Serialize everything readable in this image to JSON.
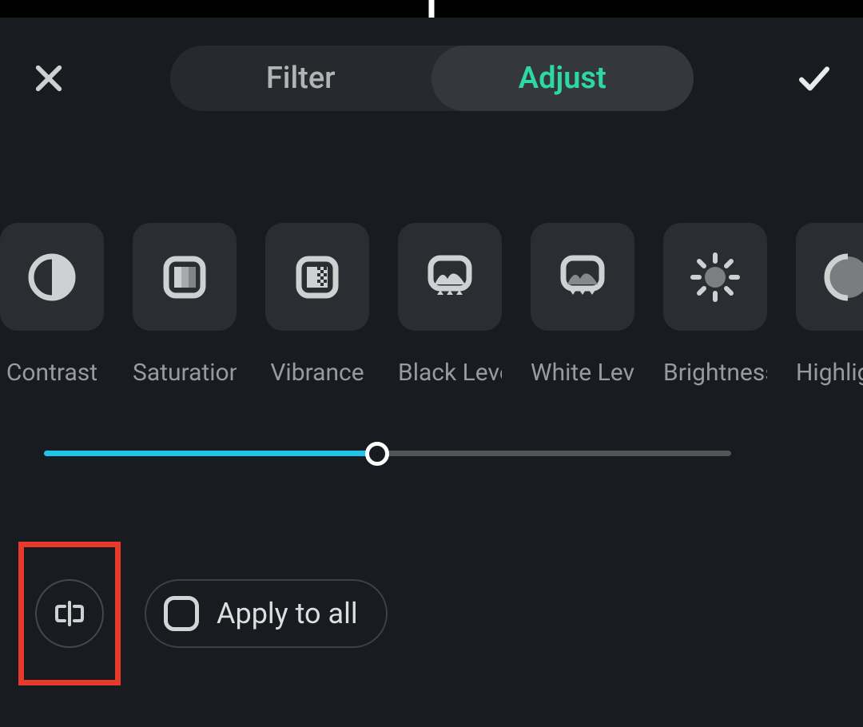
{
  "tabs": {
    "filter": "Filter",
    "adjust": "Adjust",
    "active": "adjust"
  },
  "adjustments": [
    {
      "id": "contrast",
      "label": "Contrast"
    },
    {
      "id": "saturation",
      "label": "Saturation"
    },
    {
      "id": "vibrance",
      "label": "Vibrance"
    },
    {
      "id": "black-level",
      "label": "Black Level"
    },
    {
      "id": "white-level",
      "label": "White Level"
    },
    {
      "id": "brightness",
      "label": "Brightness"
    },
    {
      "id": "highlights",
      "label": "Highlights"
    }
  ],
  "slider": {
    "value": 0,
    "min": -50,
    "max": 50
  },
  "apply_all": {
    "label": "Apply to all",
    "checked": false
  },
  "colors": {
    "accent": "#2dd8a3",
    "slider_fill": "#20c4e8",
    "highlight": "#e73a2d"
  }
}
